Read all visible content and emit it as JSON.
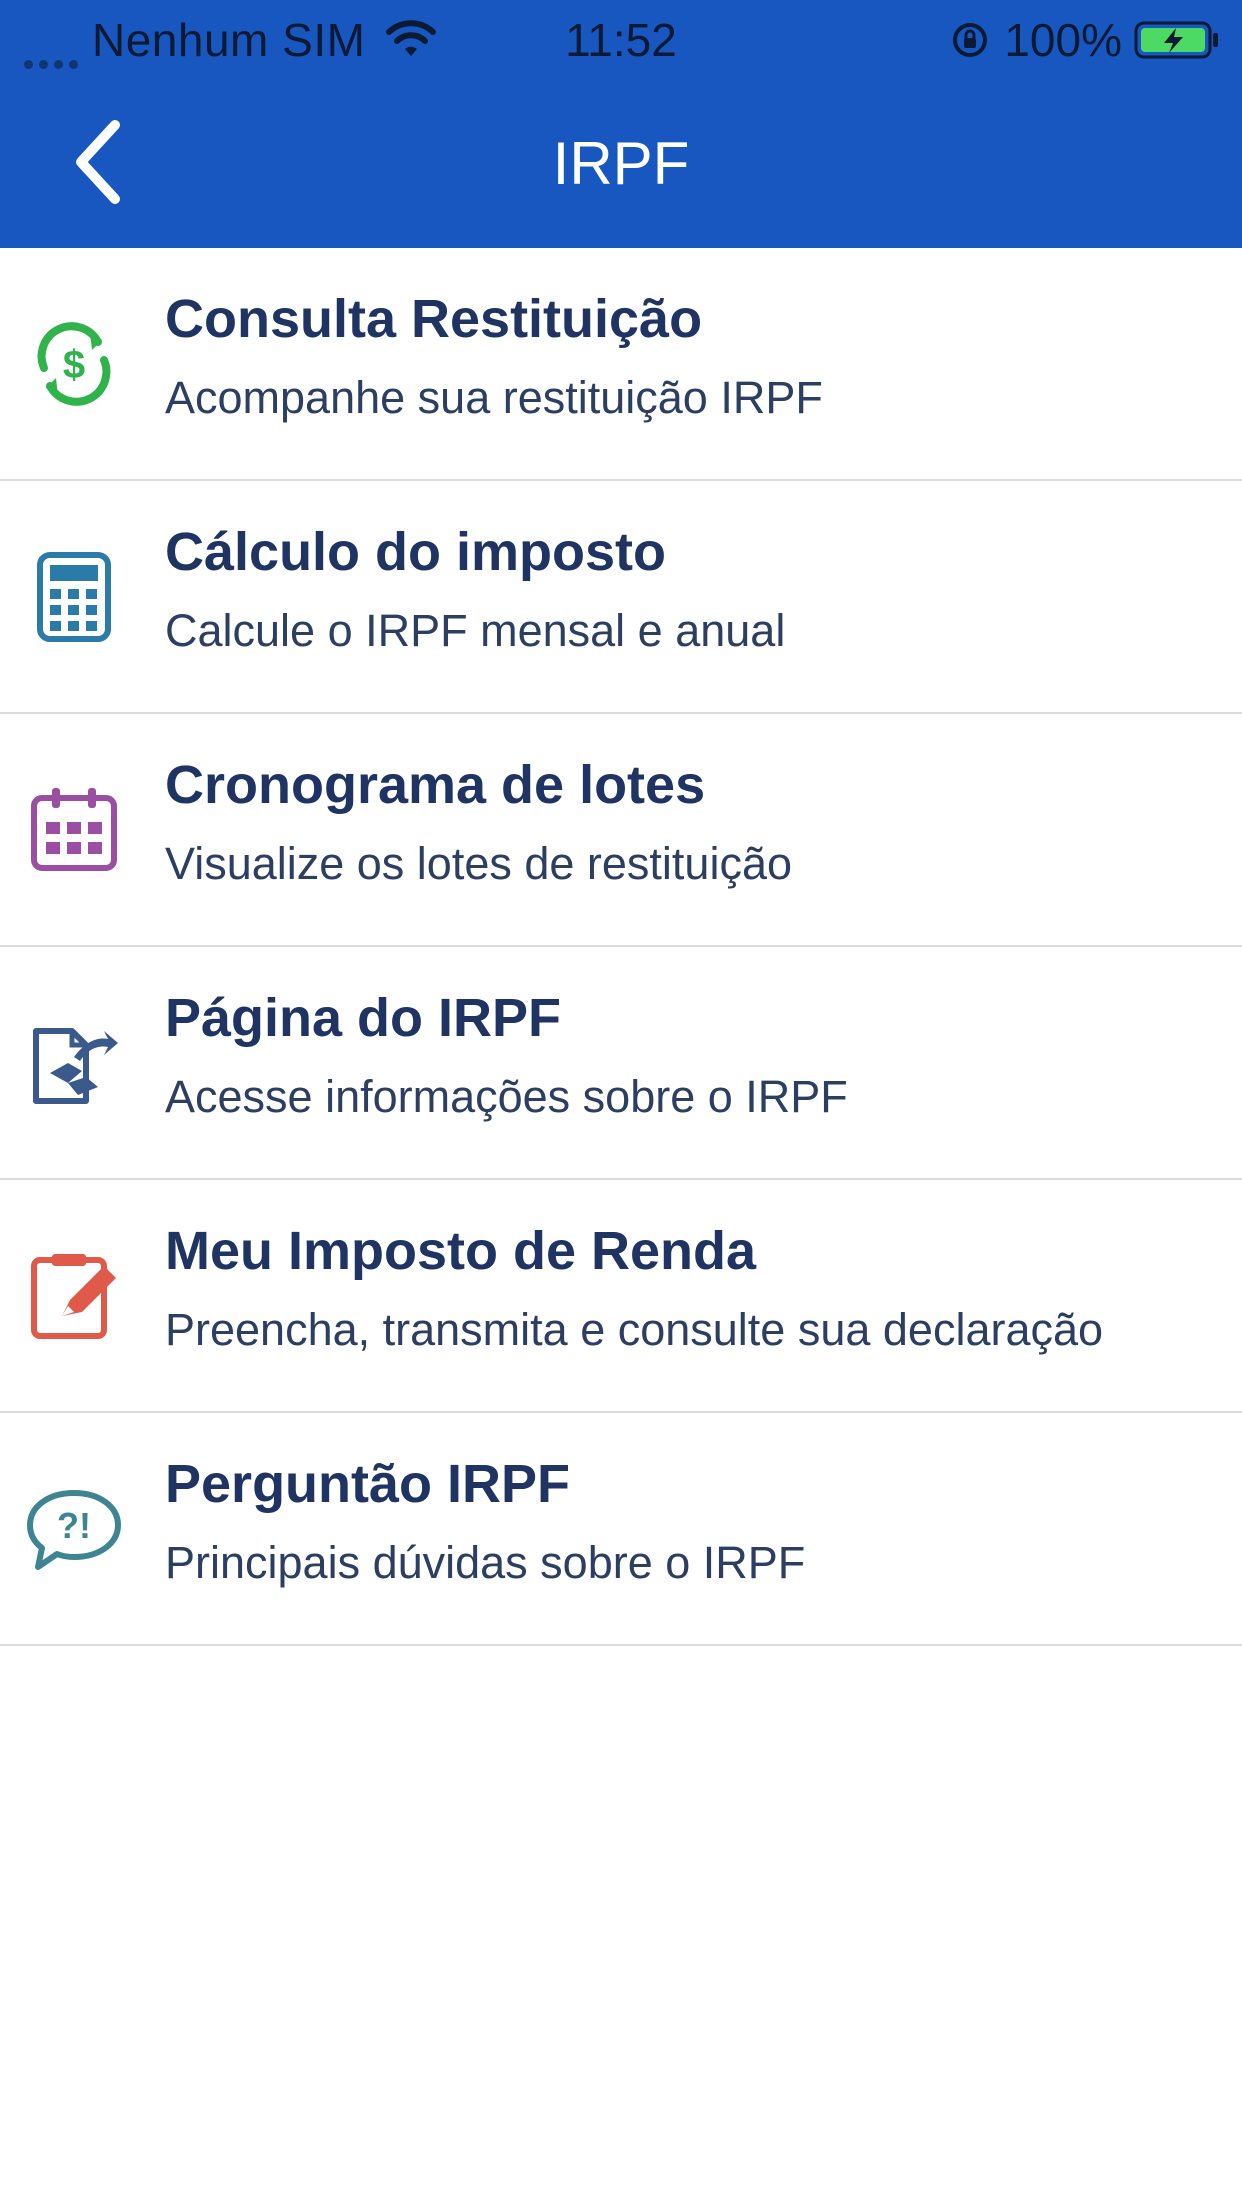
{
  "status_bar": {
    "carrier": "Nenhum SIM",
    "time": "11:52",
    "battery": "100%",
    "icons": [
      "signal-dots-icon",
      "wifi-icon",
      "rotation-lock-icon",
      "battery-charging-icon"
    ]
  },
  "nav": {
    "title": "IRPF",
    "back_icon": "chevron-left-icon"
  },
  "colors": {
    "header_bg": "#1857c0",
    "title_text": "#1f3462",
    "green_icon": "#2fb34a",
    "blue_icon": "#2b7ba8",
    "purple_icon": "#9b4fa3",
    "navy_icon": "#3a5a8c",
    "red_icon": "#e05a4a",
    "teal_icon": "#3e8591"
  },
  "menu": {
    "items": [
      {
        "title": "Consulta Restituição",
        "subtitle": "Acompanhe sua restituição IRPF",
        "icon": "dollar-refresh-icon"
      },
      {
        "title": "Cálculo do imposto",
        "subtitle": "Calcule o IRPF mensal e anual",
        "icon": "calculator-icon"
      },
      {
        "title": "Cronograma de lotes",
        "subtitle": "Visualize os lotes de restituição",
        "icon": "calendar-icon"
      },
      {
        "title": "Página do IRPF",
        "subtitle": "Acesse informações sobre o IRPF",
        "icon": "document-share-icon"
      },
      {
        "title": "Meu Imposto de Renda",
        "subtitle": "Preencha, transmita e consulte sua declaração",
        "icon": "edit-document-icon"
      },
      {
        "title": "Perguntão IRPF",
        "subtitle": "Principais dúvidas sobre o IRPF",
        "icon": "question-bubble-icon"
      }
    ]
  }
}
